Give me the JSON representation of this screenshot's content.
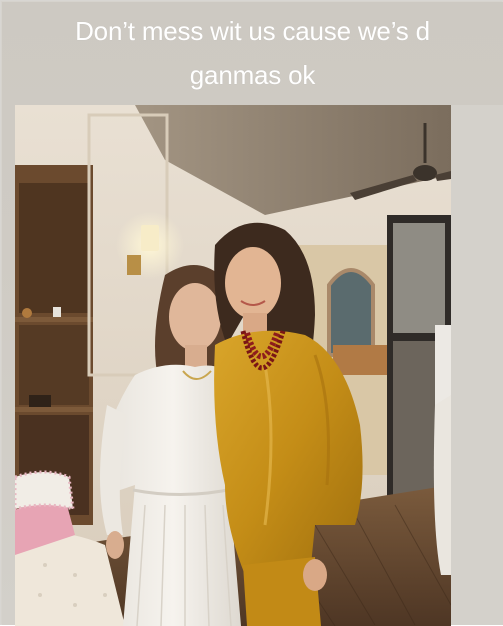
{
  "story": {
    "caption_line1": "Don’t mess wit us cause we’s d",
    "caption_line2": "ganmas ok"
  },
  "photo": {
    "colors": {
      "background": "#d0ccc5",
      "wall": "#e6ddcf",
      "ceiling": "#8d7f6e",
      "mustard_outfit": "#c9921a",
      "white_dress": "#f1eee9",
      "necklace": "#8e1c1c",
      "floor": "#6a4d33"
    }
  }
}
